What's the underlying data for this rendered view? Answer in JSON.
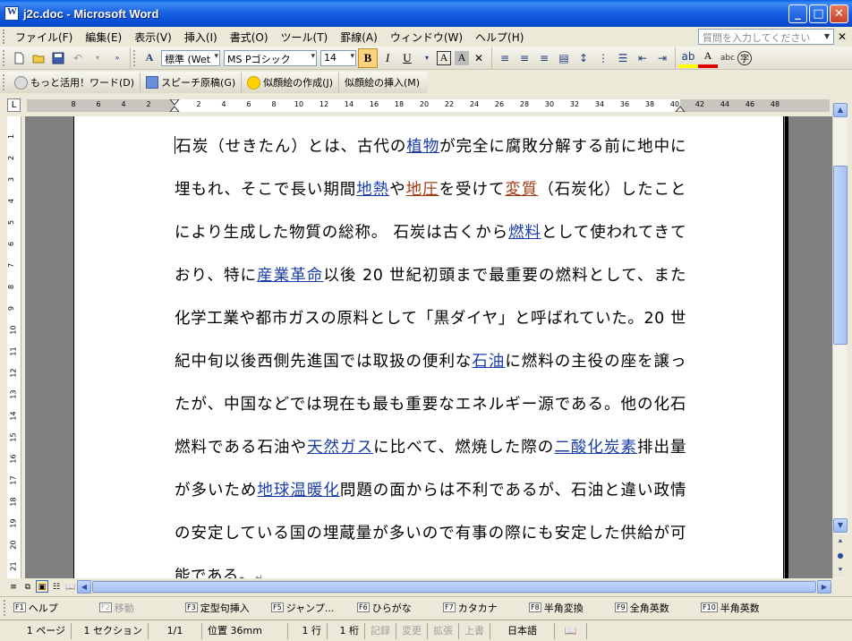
{
  "window": {
    "title": "j2c.doc - Microsoft Word"
  },
  "menu": {
    "items": [
      "ファイル(F)",
      "編集(E)",
      "表示(V)",
      "挿入(I)",
      "書式(O)",
      "ツール(T)",
      "罫線(A)",
      "ウィンドウ(W)",
      "ヘルプ(H)"
    ],
    "help_placeholder": "質問を入力してください"
  },
  "format": {
    "style": "標準 (Wet",
    "font": "MS Pゴシック",
    "size": "14"
  },
  "quickbar": {
    "item1": "もっと活用！ワード(D)",
    "item2": "スピーチ原稿(G)",
    "item3": "似顔絵の作成(J)",
    "item4": "似顔絵の挿入(M)"
  },
  "ruler": {
    "marks": [
      "8",
      "6",
      "4",
      "2",
      "2",
      "4",
      "6",
      "8",
      "10",
      "12",
      "14",
      "16",
      "18",
      "20",
      "22",
      "24",
      "26",
      "28",
      "30",
      "32",
      "34",
      "36",
      "38",
      "40",
      "42",
      "44",
      "46",
      "48"
    ],
    "vmarks": [
      "1",
      "2",
      "3",
      "4",
      "5",
      "6",
      "7",
      "8",
      "9",
      "10",
      "11",
      "12",
      "13",
      "14",
      "15",
      "16",
      "17",
      "18",
      "19",
      "20",
      "21"
    ]
  },
  "document": {
    "t1": "石炭（せきたん）とは、古代の",
    "l1": "植物",
    "t2": "が完全に腐敗分解する前に地中に埋もれ、そこで長い期間",
    "l2": "地熱",
    "t3": "や",
    "l3": "地圧",
    "t4": "を受けて",
    "l4": "変質",
    "t5": "（石炭化）したことにより生成した物質の総称。 石炭は古くから",
    "l5": "燃料",
    "t6": "として使われてきており、特に",
    "l6": "産業革命",
    "t7": "以後 20 世紀初頭まで最重要の燃料として、また化学工業や都市ガスの原料として「黒ダイヤ」と呼ばれていた。20 世紀中旬以後西側先進国では取扱の便利な",
    "l7": "石油",
    "t8": "に燃料の主役の座を譲ったが、中国などでは現在も最も重要なエネルギー源である。他の化石燃料である石油や",
    "l8": "天然ガス",
    "t9": "に比べて、燃焼した際の",
    "l9": "二酸化炭素",
    "t10": "排出量が多いため",
    "l10": "地球温暖化",
    "t11": "問題の面からは不利であるが、石油と違い政情の安定している国の埋蔵量が多いので有事の際にも安定した供給が可能である。"
  },
  "fkeys": [
    {
      "key": "F1",
      "label": "ヘルプ"
    },
    {
      "key": "F2",
      "label": "移動"
    },
    {
      "key": "F3",
      "label": "定型句挿入"
    },
    {
      "key": "F5",
      "label": "ジャンプ..."
    },
    {
      "key": "F6",
      "label": "ひらがな"
    },
    {
      "key": "F7",
      "label": "カタカナ"
    },
    {
      "key": "F8",
      "label": "半角変換"
    },
    {
      "key": "F9",
      "label": "全角英数"
    },
    {
      "key": "F10",
      "label": "半角英数"
    }
  ],
  "status": {
    "page": "1 ページ",
    "section": "1 セクション",
    "pages": "1/1",
    "position": "位置 36mm",
    "line": "1 行",
    "column": "1 桁",
    "rec": "記録",
    "trk": "変更",
    "ext": "拡張",
    "ovr": "上書",
    "lang": "日本語"
  }
}
